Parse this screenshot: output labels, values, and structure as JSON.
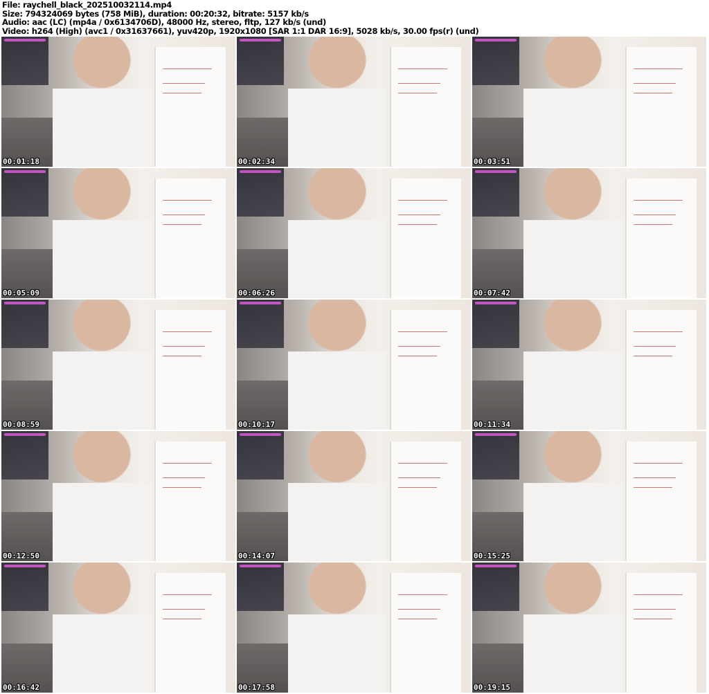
{
  "header": {
    "file": "File: raychell_black_202510032114.mp4",
    "size": "Size: 794324069 bytes (758 MiB), duration: 00:20:32, bitrate: 5157 kb/s",
    "audio": "Audio: aac (LC) (mp4a / 0x6134706D), 48000 Hz, stereo, fltp, 127 kb/s (und)",
    "video": "Video: h264 (High) (avc1 / 0x31637661), yuv420p, 1920x1080 [SAR 1:1 DAR 16:9], 5028 kb/s, 30.00 fps(r) (und)"
  },
  "frames": [
    {
      "timestamp": "00:01:18"
    },
    {
      "timestamp": "00:02:34"
    },
    {
      "timestamp": "00:03:51"
    },
    {
      "timestamp": "00:05:09"
    },
    {
      "timestamp": "00:06:26"
    },
    {
      "timestamp": "00:07:42"
    },
    {
      "timestamp": "00:08:59"
    },
    {
      "timestamp": "00:10:17"
    },
    {
      "timestamp": "00:11:34"
    },
    {
      "timestamp": "00:12:50"
    },
    {
      "timestamp": "00:14:07"
    },
    {
      "timestamp": "00:15:25"
    },
    {
      "timestamp": "00:16:42"
    },
    {
      "timestamp": "00:17:58"
    },
    {
      "timestamp": "00:19:15"
    }
  ]
}
